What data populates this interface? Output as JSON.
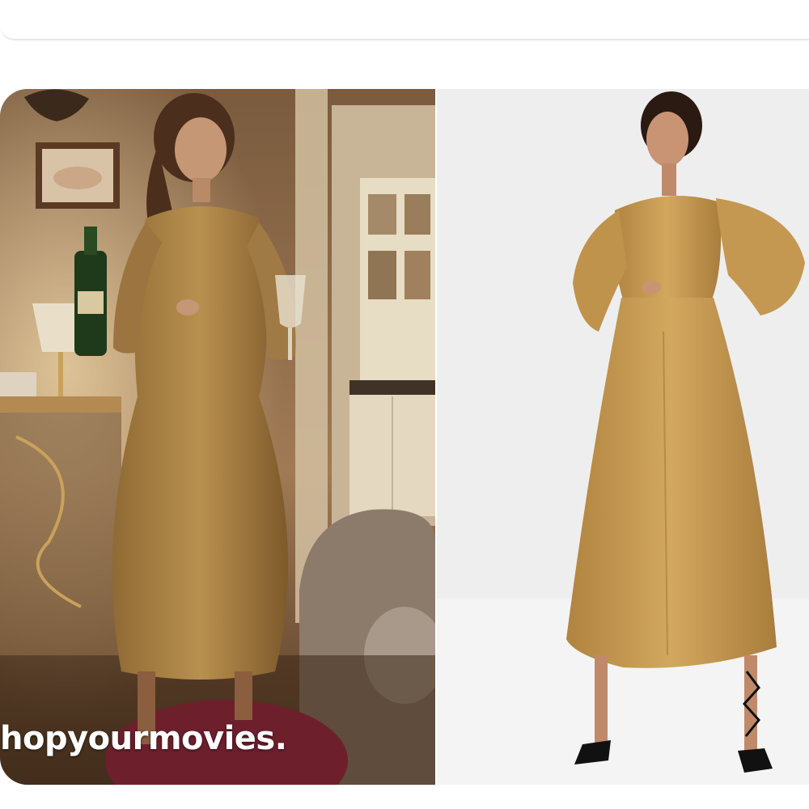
{
  "colors": {
    "page_background": "#ffffff",
    "scene_wall": "#8a6a4a",
    "dress_gold": "#c49a52",
    "studio_background": "#eeeeee",
    "burgundy_seat": "#6e1f2c"
  },
  "left_photo": {
    "description_name": "film-still",
    "watermark_text": "hopyourmovies."
  },
  "right_photo": {
    "description_name": "product-photo"
  }
}
